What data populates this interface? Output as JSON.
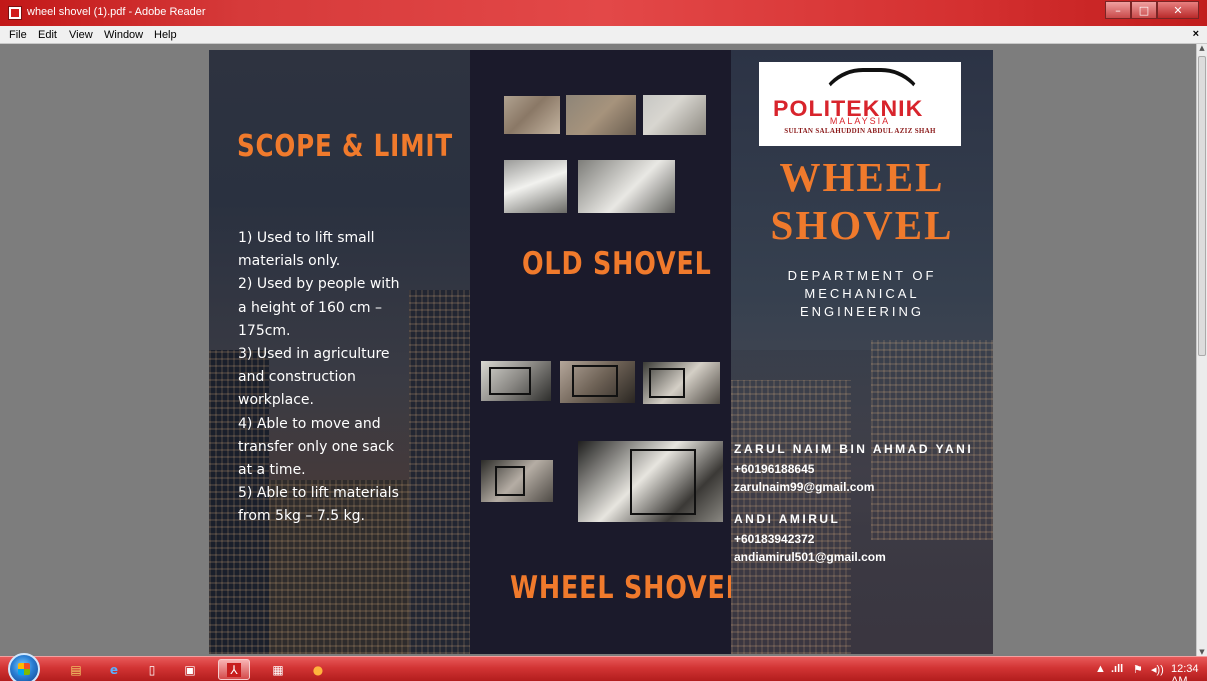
{
  "window": {
    "title": "wheel shovel (1).pdf - Adobe Reader",
    "icon": "adobe-reader-icon",
    "controls": {
      "minimize": "–",
      "maximize": "□",
      "close": "✕"
    }
  },
  "menubar": {
    "items": [
      "File",
      "Edit",
      "View",
      "Window",
      "Help"
    ],
    "close_doc": "×"
  },
  "document": {
    "left_panel": {
      "heading": "SCOPE & LIMIT",
      "lines": [
        "1)  Used to lift small",
        "materials only.",
        "2) Used by people with",
        "a height of 160 cm –",
        "175cm.",
        "3) Used in agriculture",
        "and construction",
        "workplace.",
        "4) Able to move and",
        "transfer only one sack",
        "at a time.",
        "5)  Able to lift materials",
        "from 5kg – 7.5 kg."
      ]
    },
    "middle_panel": {
      "old_heading": "OLD SHOVEL",
      "new_heading": "WHEEL SHOVEL"
    },
    "right_panel": {
      "logo": {
        "word": "POLITEKNIK",
        "sub1": "MALAYSIA",
        "sub2": "SULTAN SALAHUDDIN ABDUL AZIZ SHAH"
      },
      "title_line1": "WHEEL",
      "title_line2": "SHOVEL",
      "department": [
        "DEPARTMENT OF",
        "MECHANICAL",
        "ENGINEERING"
      ],
      "contacts": [
        {
          "name": "ZARUL NAIM BIN AHMAD YANI",
          "phone": "+60196188645",
          "email": "zarulnaim99@gmail.com"
        },
        {
          "name": "ANDI AMIRUL",
          "phone": "+60183942372",
          "email": "andiamirul501@gmail.com"
        }
      ]
    }
  },
  "taskbar": {
    "tray": {
      "time": "12:34 AM",
      "signal": ".ıll",
      "volume": "◂))",
      "arrow": "▲"
    }
  },
  "colors": {
    "accent_orange": "#f07a2c",
    "logo_red": "#d8242c",
    "titlebar_red": "#d63a3a",
    "middle_panel": "#1b1a2b"
  }
}
